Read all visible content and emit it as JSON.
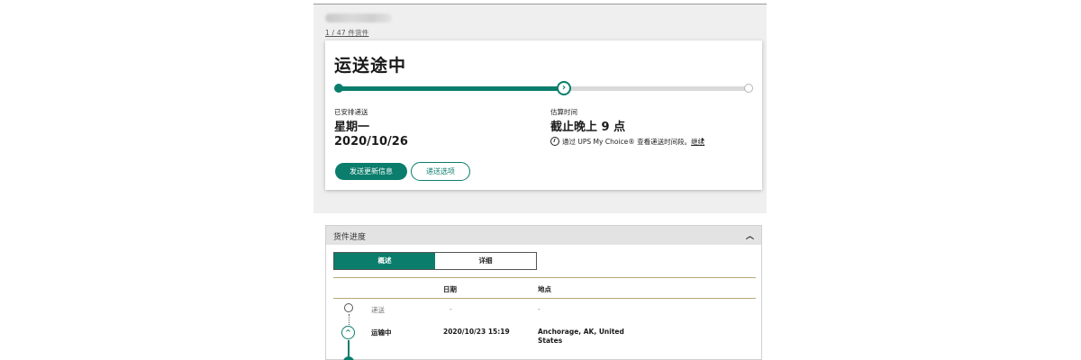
{
  "header": {
    "package_count": "1 / 47 件货件"
  },
  "status_card": {
    "title": "运送途中",
    "progress_fraction": 0.55,
    "scheduled_label": "已安排递送",
    "scheduled_day": "星期一",
    "scheduled_date": "2020/10/26",
    "estimate_label": "估算时间",
    "estimate_value": "截止晚上 9 点",
    "choice_text": "通过 UPS My Choice® 查看递送时间段。",
    "choice_link": "继续",
    "send_updates_button": "发送更新信息",
    "delivery_options_button": "递送选项"
  },
  "progress_section": {
    "title": "货件进度",
    "tabs": [
      {
        "label": "概述",
        "active": true
      },
      {
        "label": "详细",
        "active": false
      }
    ],
    "columns": {
      "date": "日期",
      "location": "地点"
    },
    "rows": [
      {
        "status": "递送",
        "date": "-",
        "location": "-",
        "state": "pending"
      },
      {
        "status": "运输中",
        "date": "2020/10/23  15:19",
        "location_line1": "Anchorage, AK, United",
        "location_line2": "States",
        "state": "current"
      }
    ]
  },
  "colors": {
    "brand_teal": "#0a7d6c",
    "panel_grey": "#efefef",
    "divider_gold": "#b7a77a"
  }
}
